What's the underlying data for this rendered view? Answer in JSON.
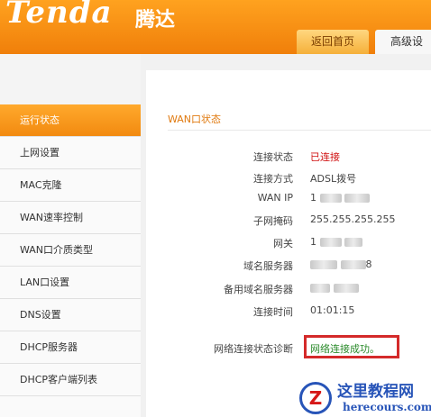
{
  "brand": {
    "logo": "Tenda",
    "logo_cn": "腾达"
  },
  "tabs": [
    {
      "label": "返回首页"
    },
    {
      "label": "高级设"
    }
  ],
  "sidebar": {
    "items": [
      {
        "label": "运行状态",
        "active": true
      },
      {
        "label": "上网设置"
      },
      {
        "label": "MAC克隆"
      },
      {
        "label": "WAN速率控制"
      },
      {
        "label": "WAN口介质类型"
      },
      {
        "label": "LAN口设置"
      },
      {
        "label": "DNS设置"
      },
      {
        "label": "DHCP服务器"
      },
      {
        "label": "DHCP客户端列表"
      }
    ]
  },
  "wan_status": {
    "title": "WAN口状态",
    "rows": [
      {
        "label": "连接状态",
        "value": "已连接"
      },
      {
        "label": "连接方式",
        "value": "ADSL拨号"
      },
      {
        "label": "WAN IP",
        "value": "1"
      },
      {
        "label": "子网掩码",
        "value": "255.255.255.255"
      },
      {
        "label": "网关",
        "value": "1"
      },
      {
        "label": "域名服务器",
        "value": "8"
      },
      {
        "label": "备用域名服务器",
        "value": ""
      },
      {
        "label": "连接时间",
        "value": "01:01:15"
      }
    ],
    "diagnosis_label": "网络连接状态诊断",
    "diagnosis_value": "网络连接成功。"
  },
  "colors": {
    "accent": "#f28a10",
    "connected": "#d01010",
    "success": "#2a8a2a",
    "highlight_box": "#d42a2a"
  },
  "watermark": {
    "cn": "这里教程网",
    "url": "herecours.com",
    "badge": "Z"
  }
}
